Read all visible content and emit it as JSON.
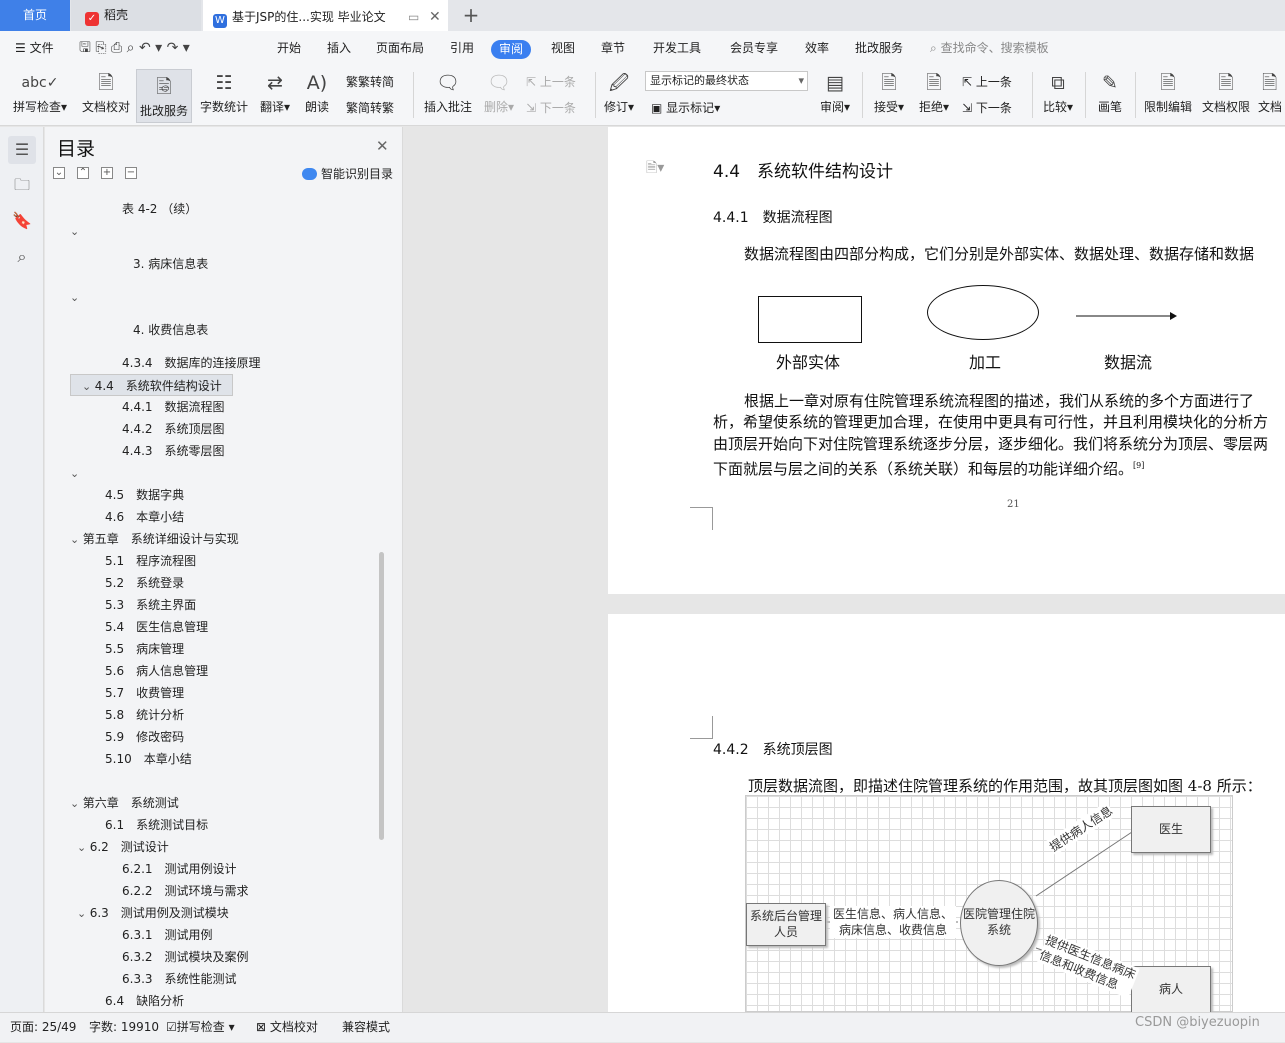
{
  "tabs": {
    "home": "首页",
    "daoke": "稻壳",
    "doc": "基于JSP的住...实现 毕业论文"
  },
  "menu": [
    "文件",
    "开始",
    "插入",
    "页面布局",
    "引用",
    "审阅",
    "视图",
    "章节",
    "开发工具",
    "会员专享",
    "效率",
    "批改服务"
  ],
  "search_placeholder": "查找命令、搜索模板",
  "ribbon": {
    "spell": "拼写检查",
    "doccheck": "文档校对",
    "correct": "批改服务",
    "wordcount": "字数统计",
    "translate": "翻译",
    "read": "朗读",
    "trad": "繁转简",
    "simp": "简转繁",
    "insert_comment": "插入批注",
    "delete": "删除",
    "prev": "上一条",
    "next": "下一条",
    "revise": "修订",
    "markup_state": "显示标记的最终状态",
    "show_markup": "显示标记",
    "review": "审阅",
    "accept": "接受",
    "reject": "拒绝",
    "prev2": "上一条",
    "next2": "下一条",
    "compare": "比较",
    "pen": "画笔",
    "restrict": "限制编辑",
    "permission": "文档权限",
    "more": "文档"
  },
  "toc": {
    "title": "目录",
    "smart": "智能识别目录",
    "items": [
      {
        "text": "表 4-2 （续）",
        "indent": 3
      },
      {
        "text": "",
        "indent": 0,
        "caret": "v"
      },
      {
        "text": "3. 病床信息表",
        "indent": 4
      },
      {
        "text": "",
        "indent": 0,
        "caret": "v"
      },
      {
        "text": "4. 收费信息表",
        "indent": 4
      },
      {
        "text": "4.3.4　数据库的连接原理",
        "indent": 3
      },
      {
        "text": "4.4　系统软件结构设计",
        "indent": 1,
        "caret": "v",
        "selected": true
      },
      {
        "text": "4.4.1　数据流程图",
        "indent": 3
      },
      {
        "text": "4.4.2　系统顶层图",
        "indent": 3
      },
      {
        "text": "4.4.3　系统零层图",
        "indent": 3
      },
      {
        "text": "",
        "indent": 0,
        "caret": "v"
      },
      {
        "text": "4.5　数据字典",
        "indent": 2
      },
      {
        "text": "4.6　本章小结",
        "indent": 2
      },
      {
        "text": "第五章　系统详细设计与实现",
        "indent": 0,
        "caret": "v"
      },
      {
        "text": "5.1　程序流程图",
        "indent": 2
      },
      {
        "text": "5.2　系统登录",
        "indent": 2
      },
      {
        "text": "5.3　系统主界面",
        "indent": 2
      },
      {
        "text": "5.4　医生信息管理",
        "indent": 2
      },
      {
        "text": "5.5　病床管理",
        "indent": 2
      },
      {
        "text": "5.6　病人信息管理",
        "indent": 2
      },
      {
        "text": "5.7　收费管理",
        "indent": 2
      },
      {
        "text": "5.8　统计分析",
        "indent": 2
      },
      {
        "text": "5.9　修改密码",
        "indent": 2
      },
      {
        "text": "5.10　本章小结",
        "indent": 2
      },
      {
        "text": "",
        "indent": 0
      },
      {
        "text": "第六章　系统测试",
        "indent": 0,
        "caret": "v"
      },
      {
        "text": "6.1　系统测试目标",
        "indent": 2
      },
      {
        "text": "6.2　测试设计",
        "indent": 1,
        "caret": "v"
      },
      {
        "text": "6.2.1　测试用例设计",
        "indent": 3
      },
      {
        "text": "6.2.2　测试环境与需求",
        "indent": 3
      },
      {
        "text": "6.3　测试用例及测试模块",
        "indent": 1,
        "caret": "v"
      },
      {
        "text": "6.3.1　测试用例",
        "indent": 3
      },
      {
        "text": "6.3.2　测试模块及案例",
        "indent": 3
      },
      {
        "text": "6.3.3　系统性能测试",
        "indent": 3
      },
      {
        "text": "6.4　缺陷分析",
        "indent": 2
      }
    ]
  },
  "page1": {
    "h3": "4.4　系统软件结构设计",
    "h4": "4.4.1　数据流程图",
    "intro": "数据流程图由四部分构成，它们分别是外部实体、数据处理、数据存储和数据",
    "legend": [
      "外部实体",
      "加工",
      "数据流"
    ],
    "para": [
      "根据上一章对原有住院管理系统流程图的描述，我们从系统的多个方面进行了",
      "析，希望使系统的管理更加合理，在使用中更具有可行性，并且利用模块化的分析方",
      "由顶层开始向下对住院管理系统逐步分层，逐步细化。我们将系统分为顶层、零层两",
      "下面就层与层之间的关系（系统关联）和每层的功能详细介绍。"
    ],
    "page_num": "21"
  },
  "page2": {
    "h4": "4.4.2　系统顶层图",
    "intro": "顶层数据流图，即描述住院管理系统的作用范围，故其顶层图如图 4-8 所示：",
    "diagram": {
      "left_box": "系统后台管理人员",
      "flow_left": "医生信息、病人信息、病床信息、收费信息",
      "center": "医院管理住院系统",
      "doctor": "医生",
      "patient": "病人",
      "flow_doctor": "提供病人信息",
      "flow_patient": "提供医生信息病床信息和收费信息"
    }
  },
  "status": {
    "page": "页面: 25/49",
    "words": "字数: 19910",
    "spell": "拼写检查",
    "check": "文档校对",
    "compat": "兼容模式"
  },
  "watermark": "CSDN @biyezuopin"
}
